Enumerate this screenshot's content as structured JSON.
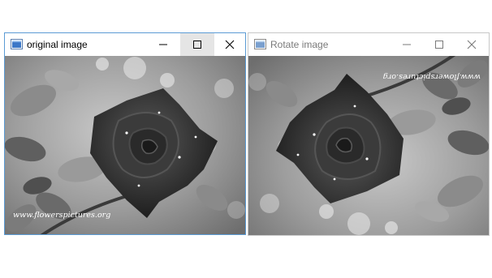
{
  "windows": [
    {
      "title": "original image",
      "state": "active",
      "controls": [
        "minimize-icon",
        "maximize-icon",
        "close-icon"
      ],
      "image": {
        "description_name": "grayscale-rose-photo",
        "watermark": "www.flowerspictures.org",
        "rotation_degrees": 0
      }
    },
    {
      "title": "Rotate image",
      "state": "inactive",
      "controls": [
        "minimize-icon",
        "maximize-icon",
        "close-icon"
      ],
      "image": {
        "description_name": "grayscale-rose-photo-rotated",
        "watermark": "www.flowerspictures.org",
        "rotation_degrees": 180
      }
    }
  ],
  "colors": {
    "active_border": "#5b9bd5",
    "inactive_border": "#c8c8c8",
    "hover_button": "#e5e5e5"
  }
}
